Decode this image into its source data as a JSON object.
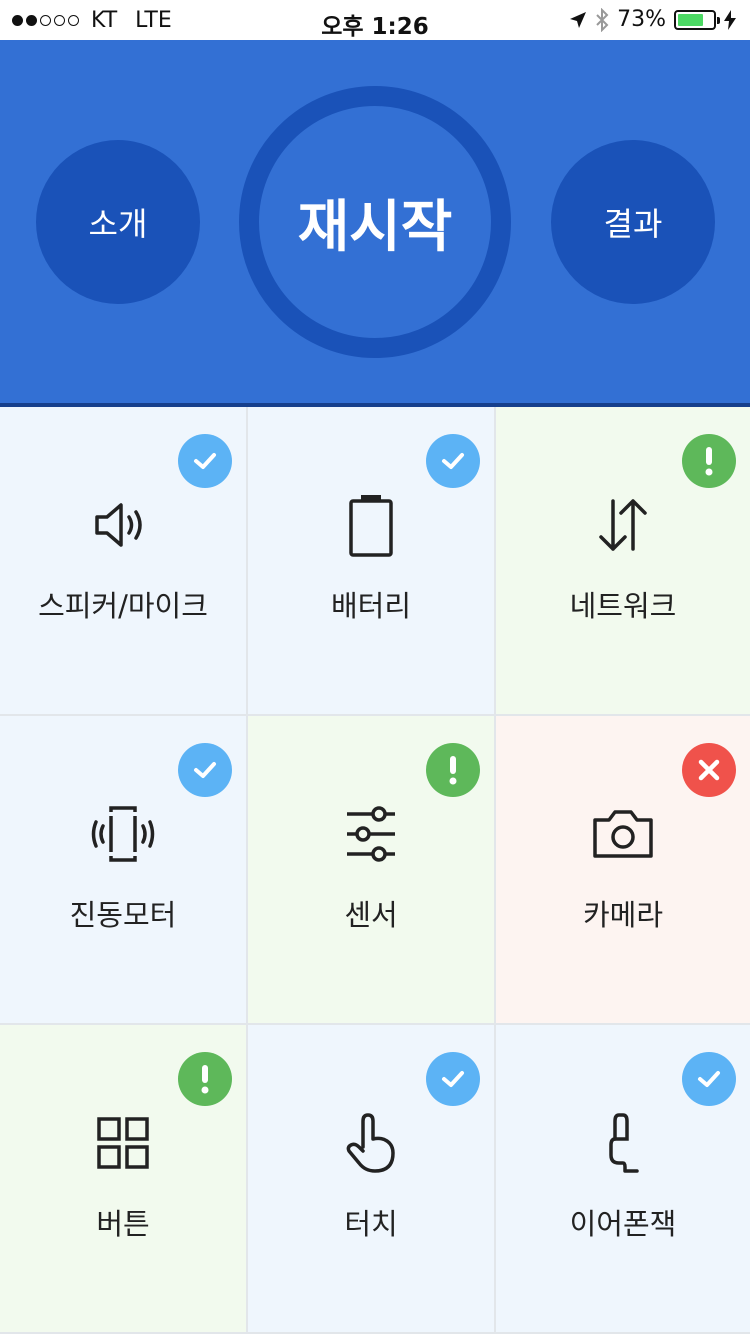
{
  "status_bar": {
    "carrier": "KT",
    "network": "LTE",
    "time": "오후 1:26",
    "battery": "73%",
    "battery_level": 0.73,
    "signal_bars_filled": 2,
    "signal_bars_total": 5
  },
  "header": {
    "intro_label": "소개",
    "restart_label": "재시작",
    "result_label": "결과"
  },
  "colors": {
    "header_bg": "#3370d4",
    "circle_bg": "#1a52b8",
    "ok": "#5cb3f5",
    "warn": "#5eb85a",
    "fail": "#f0524b"
  },
  "tests": [
    {
      "label": "스피커/마이크",
      "icon": "speaker-icon",
      "status": "ok"
    },
    {
      "label": "배터리",
      "icon": "battery-icon",
      "status": "ok"
    },
    {
      "label": "네트워크",
      "icon": "network-arrows-icon",
      "status": "warn"
    },
    {
      "label": "진동모터",
      "icon": "vibration-icon",
      "status": "ok"
    },
    {
      "label": "센서",
      "icon": "sliders-icon",
      "status": "warn"
    },
    {
      "label": "카메라",
      "icon": "camera-icon",
      "status": "fail"
    },
    {
      "label": "버튼",
      "icon": "grid-buttons-icon",
      "status": "warn"
    },
    {
      "label": "터치",
      "icon": "touch-hand-icon",
      "status": "ok"
    },
    {
      "label": "이어폰잭",
      "icon": "earphone-jack-icon",
      "status": "ok"
    }
  ]
}
